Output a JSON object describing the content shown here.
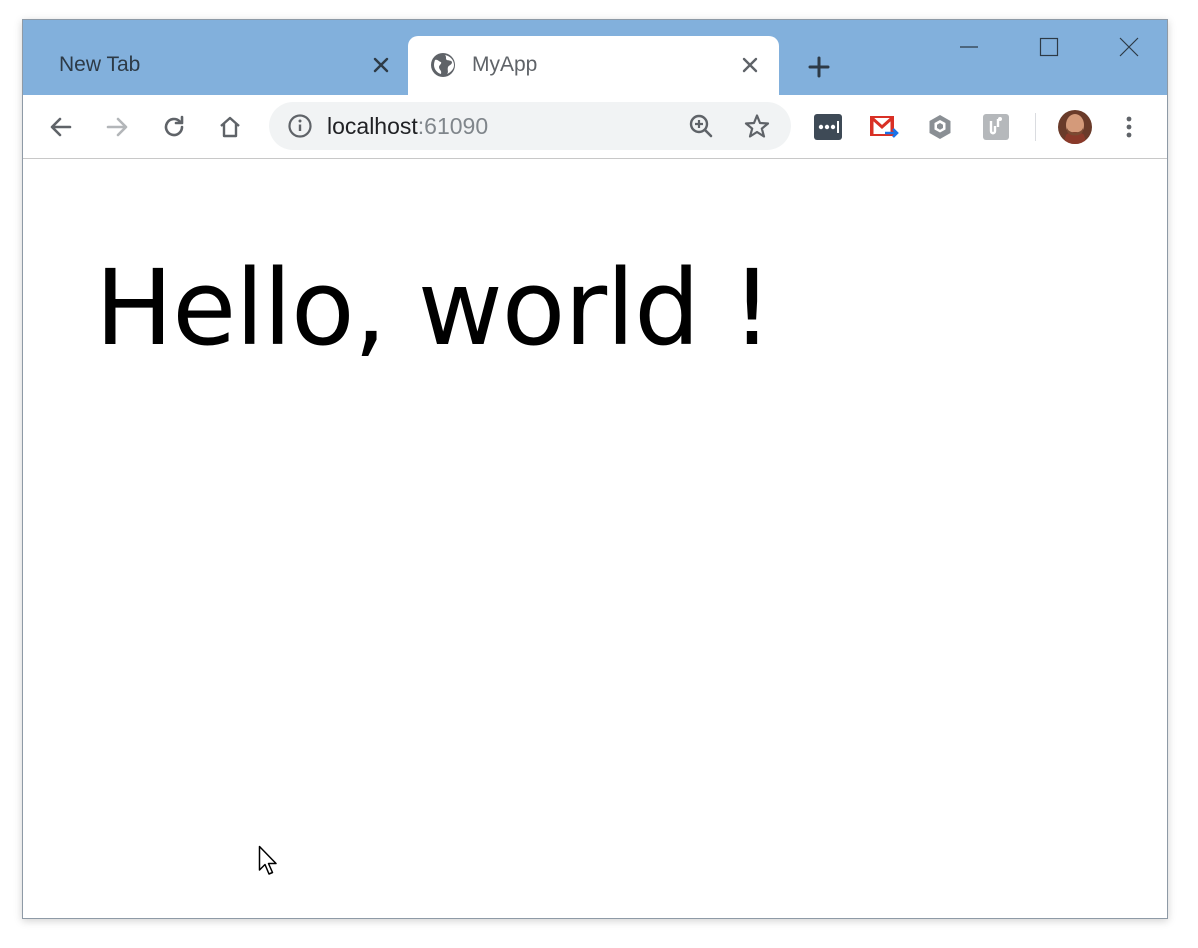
{
  "window": {
    "tabs": [
      {
        "title": "New Tab",
        "active": false
      },
      {
        "title": "MyApp",
        "active": true
      }
    ],
    "new_tab_icon": "plus-icon",
    "controls": [
      "minimize-icon",
      "maximize-icon",
      "close-icon"
    ]
  },
  "toolbar": {
    "url_host": "localhost",
    "url_port": ":61090",
    "icons": [
      "back-arrow-icon",
      "forward-arrow-icon",
      "reload-icon",
      "home-icon",
      "info-icon",
      "zoom-icon",
      "star-icon"
    ],
    "extensions": [
      "lastpass-icon",
      "gmail-checker-icon",
      "hexagon-extension-icon",
      "puzzle-extension-icon"
    ],
    "menu_icon": "kebab-menu-icon"
  },
  "page": {
    "heading": "Hello, world !"
  },
  "colors": {
    "titlebar": "#82b0dc",
    "omnibox": "#f1f3f4"
  }
}
